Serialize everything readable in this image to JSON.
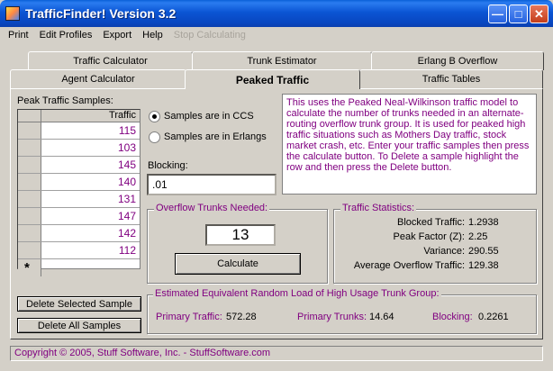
{
  "window": {
    "title": "TrafficFinder! Version 3.2"
  },
  "menu": [
    "Print",
    "Edit Profiles",
    "Export",
    "Help",
    "Stop Calculating"
  ],
  "tabs_back": [
    "Traffic Calculator",
    "Trunk Estimator",
    "Erlang B Overflow"
  ],
  "tabs_front": [
    "Agent Calculator",
    "Peaked Traffic",
    "Traffic Tables"
  ],
  "peak": {
    "samples_label": "Peak Traffic Samples:",
    "column_header": "Traffic",
    "samples": [
      "115",
      "103",
      "145",
      "140",
      "131",
      "147",
      "142",
      "112"
    ],
    "new_row_marker": "*",
    "radio_ccs": "Samples are in CCS",
    "radio_erlangs": "Samples are in Erlangs",
    "selected_unit": "CCS",
    "blocking_label": "Blocking:",
    "blocking_value": ".01",
    "description": "This uses the Peaked Neal-Wilkinson traffic model to calculate the number of trunks needed in an alternate-routing overflow trunk group.  It is used for peaked high traffic situations such as Mothers Day traffic, stock market crash, etc.  Enter your traffic samples then press the calculate button.  To Delete a sample highlight the row and then press the Delete button.",
    "overflow_title": "Overflow Trunks Needed:",
    "overflow_value": "13",
    "calculate": "Calculate",
    "stats_title": "Traffic Statistics:",
    "stats": [
      {
        "label": "Blocked Traffic:",
        "value": "1.2938"
      },
      {
        "label": "Peak Factor (Z):",
        "value": "2.25"
      },
      {
        "label": "Variance:",
        "value": "290.55"
      },
      {
        "label": "Average Overflow Traffic:",
        "value": "129.38"
      }
    ],
    "delete_selected": "Delete Selected Sample",
    "delete_all": "Delete All Samples",
    "equiv_title": "Estimated Equivalent Random Load of High Usage Trunk Group:",
    "primary_traffic_label": "Primary Traffic:",
    "primary_traffic_value": "572.28",
    "primary_trunks_label": "Primary Trunks:",
    "primary_trunks_value": "14.64",
    "blocking_out_label": "Blocking:",
    "blocking_out_value": "0.2261"
  },
  "status": "Copyright © 2005, Stuff Software, Inc. - StuffSoftware.com",
  "icons": [
    "app-icon",
    "minimize-icon",
    "maximize-icon",
    "close-icon",
    "new-row-icon"
  ],
  "colors": {
    "accent_text": "#800080",
    "titlebar": "#0b55d4"
  }
}
